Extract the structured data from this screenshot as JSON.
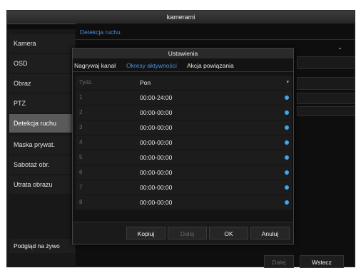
{
  "window": {
    "title": "kamerami"
  },
  "sidebar": {
    "items": [
      {
        "label": "Kamera"
      },
      {
        "label": "OSD"
      },
      {
        "label": "Obraz"
      },
      {
        "label": "PTZ"
      },
      {
        "label": "Detekcja ruchu"
      },
      {
        "label": "Maska prywat."
      },
      {
        "label": "Sabotaż obr."
      },
      {
        "label": "Utrata obrazu"
      }
    ],
    "active_index": 4,
    "live_view_label": "Podgląd na żywo"
  },
  "content": {
    "tab_label": "Detekcja ruchu",
    "next_label": "Dalej",
    "back_label": "Wstecz"
  },
  "dialog": {
    "title": "Ustawienia",
    "tabs": [
      {
        "label": "Nagrywaj kanał"
      },
      {
        "label": "Okresy aktywności"
      },
      {
        "label": "Akcja powiązania"
      }
    ],
    "active_tab": 1,
    "week_label": "Tydz.",
    "week_value": "Pon",
    "periods": [
      {
        "num": "1",
        "time": "00:00-24:00"
      },
      {
        "num": "2",
        "time": "00:00-00:00"
      },
      {
        "num": "3",
        "time": "00:00-00:00"
      },
      {
        "num": "4",
        "time": "00:00-00:00"
      },
      {
        "num": "5",
        "time": "00:00-00:00"
      },
      {
        "num": "6",
        "time": "00:00-00:00"
      },
      {
        "num": "7",
        "time": "00:00-00:00"
      },
      {
        "num": "8",
        "time": "00:00-00:00"
      }
    ],
    "buttons": {
      "copy": "Kopiuj",
      "next": "Dalej",
      "ok": "OK",
      "cancel": "Anuluj"
    }
  },
  "colors": {
    "accent": "#4a8fe0",
    "dot": "#3ea8f0",
    "active_sidebar": "#5a5a5a"
  }
}
